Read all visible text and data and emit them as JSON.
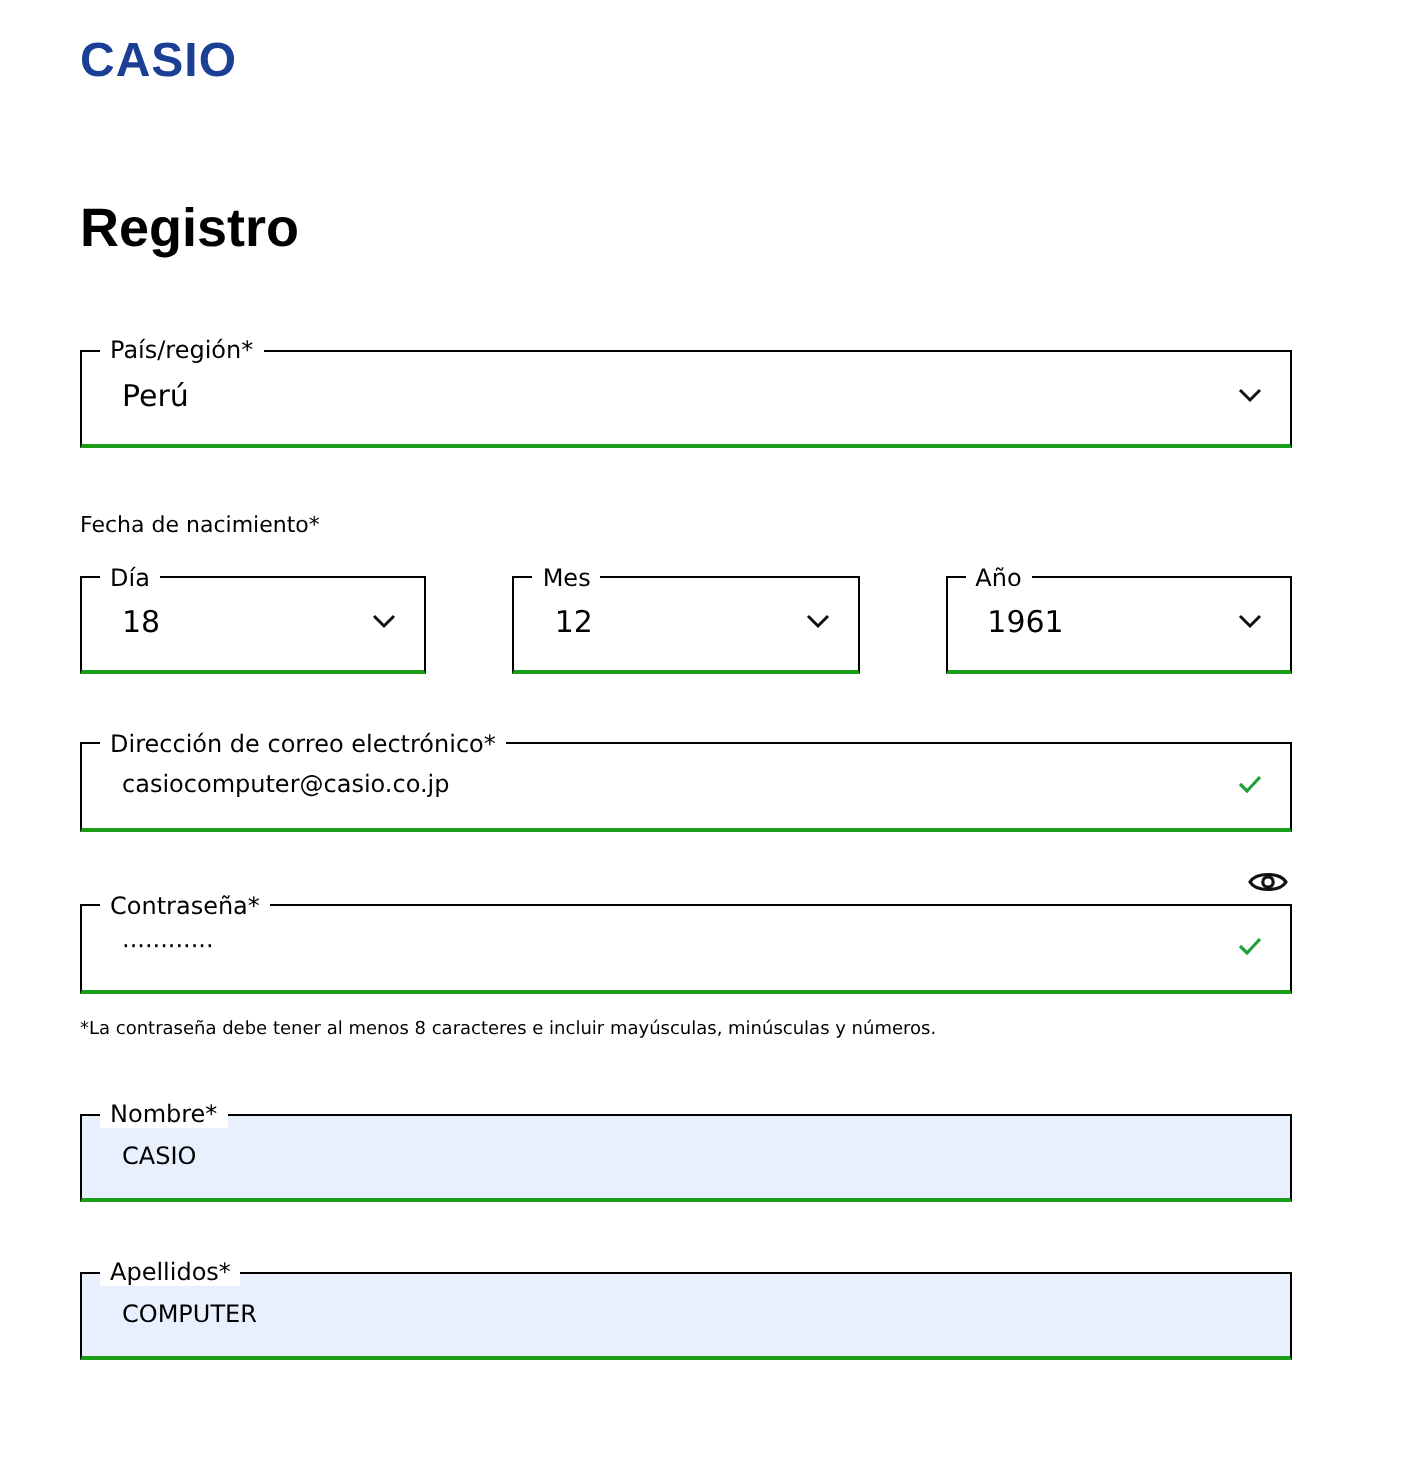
{
  "logo": "CASIO",
  "title": "Registro",
  "country": {
    "label": "País/región*",
    "value": "Perú",
    "kind": "select"
  },
  "birth_date": {
    "label": "Fecha de nacimiento*",
    "parts": [
      {
        "label": "Día",
        "value": "18",
        "kind": "select"
      },
      {
        "label": "Mes",
        "value": "12",
        "kind": "select"
      },
      {
        "label": "Año",
        "value": "1961",
        "kind": "select"
      }
    ]
  },
  "fields": [
    {
      "label": "Dirección de correo electrónico*",
      "value": "casiocomputer@casio.co.jp",
      "kind": "text",
      "valid": true,
      "autofilled": false
    },
    {
      "label": "Contraseña*",
      "value": "············",
      "kind": "password",
      "valid": true,
      "autofilled": false,
      "note": "*La contraseña debe tener al menos 8 caracteres e incluir mayúsculas, minúsculas y números."
    },
    {
      "label": "Nombre*",
      "value": "CASIO",
      "kind": "text",
      "valid": false,
      "autofilled": true
    },
    {
      "label": "Apellidos*",
      "value": "COMPUTER",
      "kind": "text",
      "valid": false,
      "autofilled": true
    }
  ]
}
